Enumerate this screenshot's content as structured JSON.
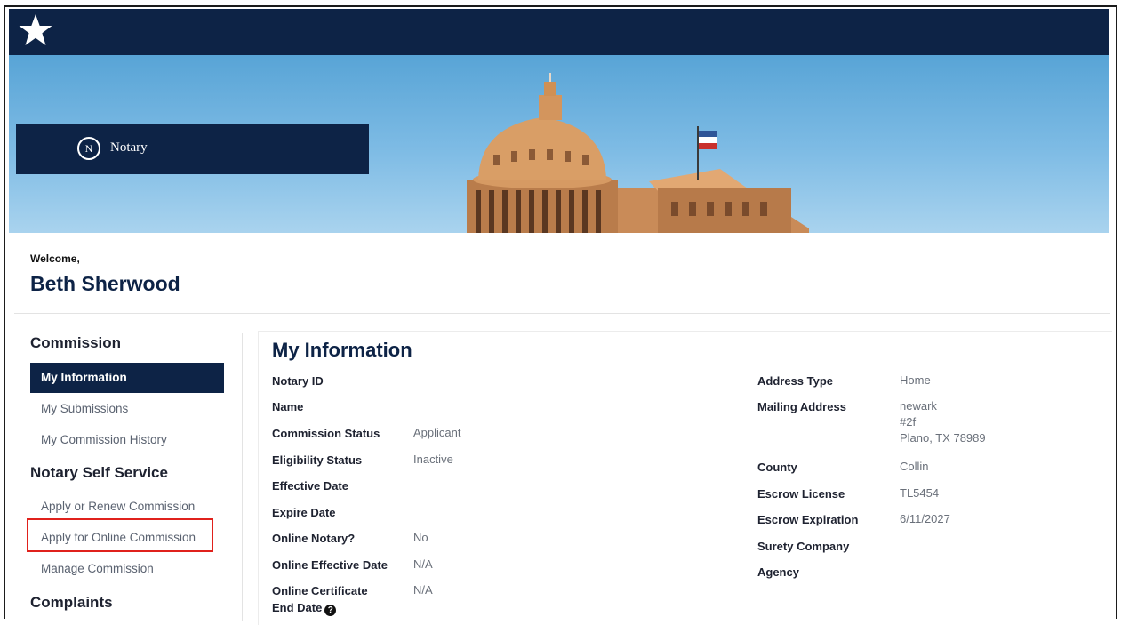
{
  "banner": {
    "portal_name": "Notary",
    "logo_letter": "N"
  },
  "welcome": {
    "greeting": "Welcome,",
    "user_name": "Beth Sherwood"
  },
  "sidebar": {
    "sections": [
      {
        "heading": "Commission",
        "items": [
          {
            "label": "My Information",
            "active": true
          },
          {
            "label": "My Submissions",
            "active": false
          },
          {
            "label": "My Commission History",
            "active": false
          }
        ]
      },
      {
        "heading": "Notary Self Service",
        "items": [
          {
            "label": "Apply or Renew Commission",
            "active": false
          },
          {
            "label": "Apply for Online Commission",
            "active": false
          },
          {
            "label": "Manage Commission",
            "active": false
          }
        ]
      },
      {
        "heading": "Complaints",
        "items": []
      }
    ]
  },
  "main": {
    "title": "My Information",
    "left_fields": [
      {
        "label": "Notary ID",
        "value": ""
      },
      {
        "label": "Name",
        "value": ""
      },
      {
        "label": "Commission Status",
        "value": "Applicant"
      },
      {
        "label": "Eligibility Status",
        "value": "Inactive"
      },
      {
        "label": "Effective Date",
        "value": ""
      },
      {
        "label": "Expire Date",
        "value": ""
      },
      {
        "label": "Online Notary?",
        "value": "No"
      },
      {
        "label": "Online Effective Date",
        "value": "N/A"
      },
      {
        "label_line1": "Online Certificate",
        "label_line2": "End Date",
        "value": "N/A"
      }
    ],
    "right_fields": [
      {
        "label": "Address Type",
        "value": "Home"
      },
      {
        "label": "Mailing Address",
        "value_lines": [
          "newark",
          "#2f",
          "Plano, TX 78989"
        ]
      },
      {
        "label": "County",
        "value": "Collin"
      },
      {
        "label": "Escrow License",
        "value": "TL5454"
      },
      {
        "label": "Escrow Expiration",
        "value": "6/11/2027"
      },
      {
        "label": "Surety Company",
        "value": ""
      },
      {
        "label": "Agency",
        "value": ""
      }
    ]
  },
  "colors": {
    "navy": "#0d2346",
    "highlight_red": "#e0211c",
    "sky": "#7fbce5"
  },
  "icons": [
    "star-icon",
    "notary-circle-icon",
    "help-icon",
    "flag-icon"
  ]
}
